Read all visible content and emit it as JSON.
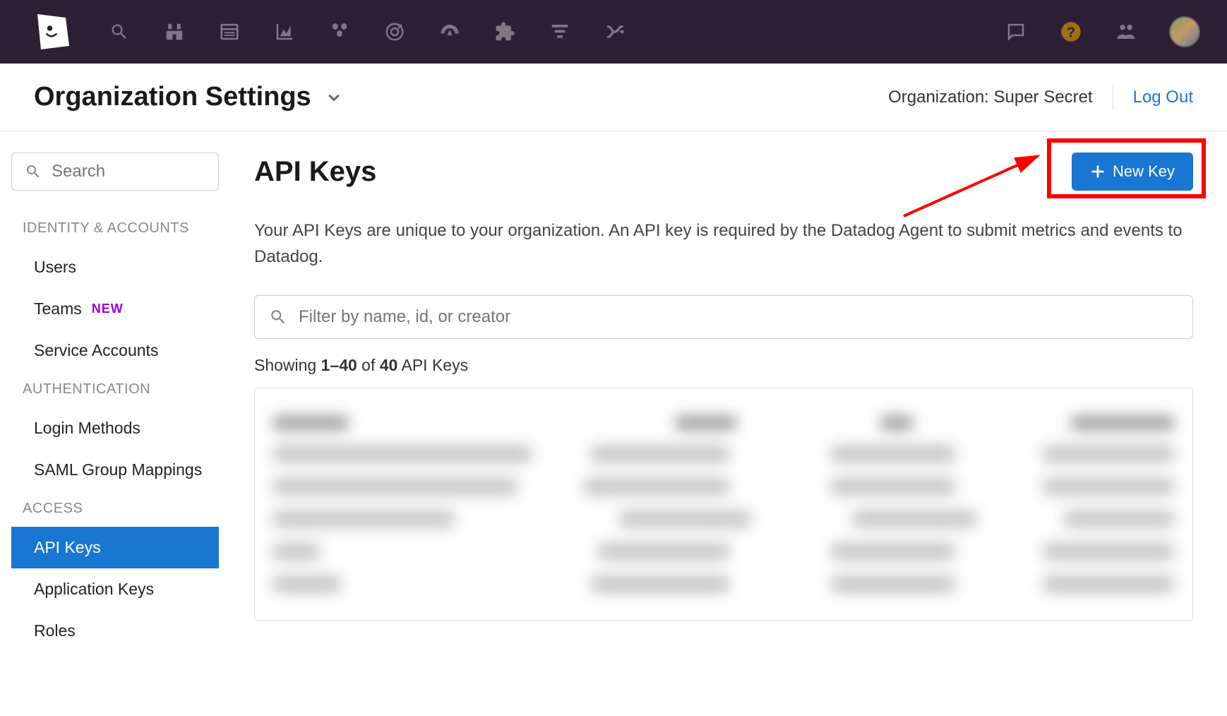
{
  "header": {
    "page_title": "Organization Settings",
    "org_label": "Organization: Super Secret",
    "logout": "Log Out"
  },
  "sidebar": {
    "search_placeholder": "Search",
    "sections": [
      {
        "title": "IDENTITY & ACCOUNTS",
        "items": [
          {
            "label": "Users",
            "active": false,
            "badge": null
          },
          {
            "label": "Teams",
            "active": false,
            "badge": "NEW"
          },
          {
            "label": "Service Accounts",
            "active": false,
            "badge": null
          }
        ]
      },
      {
        "title": "AUTHENTICATION",
        "items": [
          {
            "label": "Login Methods",
            "active": false,
            "badge": null
          },
          {
            "label": "SAML Group Mappings",
            "active": false,
            "badge": null
          }
        ]
      },
      {
        "title": "ACCESS",
        "items": [
          {
            "label": "API Keys",
            "active": true,
            "badge": null
          },
          {
            "label": "Application Keys",
            "active": false,
            "badge": null
          },
          {
            "label": "Roles",
            "active": false,
            "badge": null
          }
        ]
      }
    ]
  },
  "main": {
    "title": "API Keys",
    "description": "Your API Keys are unique to your organization. An API key is required by the Datadog Agent to submit metrics and events to Datadog.",
    "filter_placeholder": "Filter by name, id, or creator",
    "showing_prefix": "Showing ",
    "showing_range": "1–40",
    "showing_of": " of ",
    "showing_total": "40",
    "showing_suffix": " API Keys",
    "new_key_label": "New Key"
  }
}
